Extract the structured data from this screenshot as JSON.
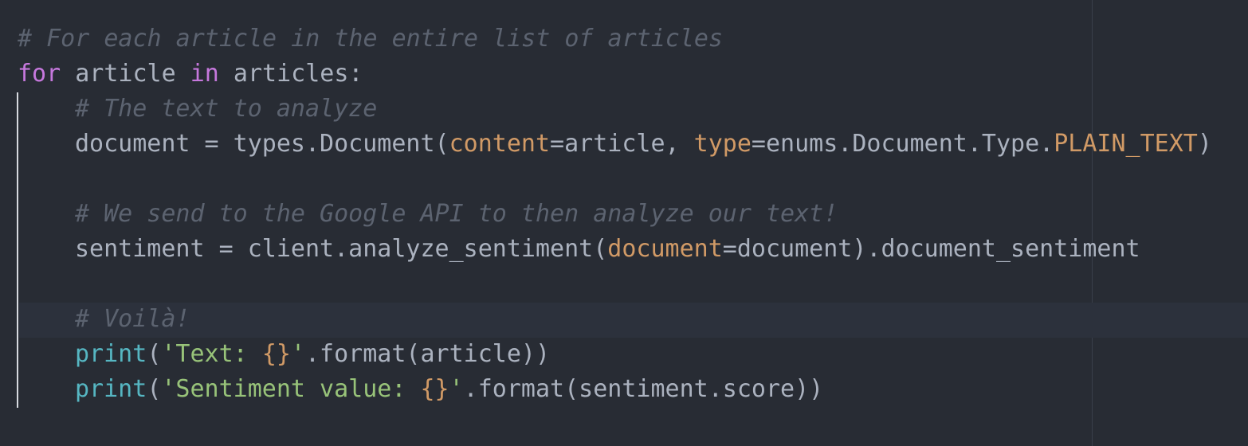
{
  "editor": {
    "line1": {
      "comment": "# For each article in the entire list of articles"
    },
    "line2": {
      "kw_for": "for",
      "var": " article ",
      "kw_in": "in",
      "iter": " articles:"
    },
    "line3": {
      "comment": "# The text to analyze"
    },
    "line4": {
      "lhs": "document = types.Document(",
      "p1": "content",
      "mid1": "=article, ",
      "p2": "type",
      "mid2": "=enums.Document.Type.",
      "const": "PLAIN_TEXT",
      "end": ")"
    },
    "line6": {
      "comment": "# We send to the Google API to then analyze our text!"
    },
    "line7": {
      "lhs": "sentiment = client.analyze_sentiment(",
      "p1": "document",
      "rest": "=document).document_sentiment"
    },
    "line9": {
      "comment": "# Voilà!"
    },
    "line10": {
      "fn": "print",
      "open": "(",
      "str1": "'Text: ",
      "brace": "{}",
      "str2": "'",
      "rest": ".format(article))"
    },
    "line11": {
      "fn": "print",
      "open": "(",
      "str1": "'Sentiment value: ",
      "brace": "{}",
      "str2": "'",
      "rest": ".format(sentiment.score))"
    }
  },
  "colors": {
    "background": "#282c34",
    "comment": "#5c6370",
    "keyword": "#c678dd",
    "parameter": "#d19a66",
    "builtin": "#56b6c2",
    "string": "#98c379",
    "text": "#abb2bf"
  }
}
